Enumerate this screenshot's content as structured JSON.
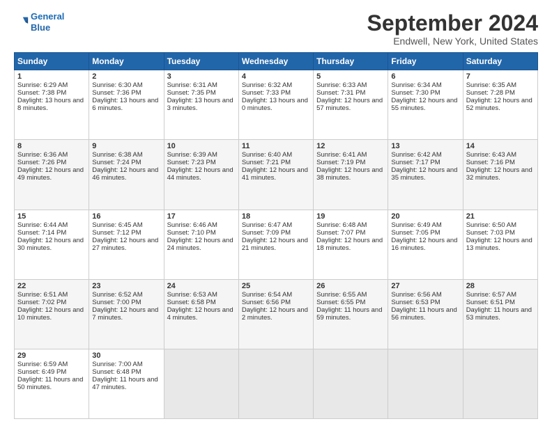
{
  "logo": {
    "line1": "General",
    "line2": "Blue"
  },
  "title": "September 2024",
  "location": "Endwell, New York, United States",
  "days_header": [
    "Sunday",
    "Monday",
    "Tuesday",
    "Wednesday",
    "Thursday",
    "Friday",
    "Saturday"
  ],
  "weeks": [
    [
      {
        "day": "1",
        "info": "Sunrise: 6:29 AM\nSunset: 7:38 PM\nDaylight: 13 hours and 8 minutes."
      },
      {
        "day": "2",
        "info": "Sunrise: 6:30 AM\nSunset: 7:36 PM\nDaylight: 13 hours and 6 minutes."
      },
      {
        "day": "3",
        "info": "Sunrise: 6:31 AM\nSunset: 7:35 PM\nDaylight: 13 hours and 3 minutes."
      },
      {
        "day": "4",
        "info": "Sunrise: 6:32 AM\nSunset: 7:33 PM\nDaylight: 13 hours and 0 minutes."
      },
      {
        "day": "5",
        "info": "Sunrise: 6:33 AM\nSunset: 7:31 PM\nDaylight: 12 hours and 57 minutes."
      },
      {
        "day": "6",
        "info": "Sunrise: 6:34 AM\nSunset: 7:30 PM\nDaylight: 12 hours and 55 minutes."
      },
      {
        "day": "7",
        "info": "Sunrise: 6:35 AM\nSunset: 7:28 PM\nDaylight: 12 hours and 52 minutes."
      }
    ],
    [
      {
        "day": "8",
        "info": "Sunrise: 6:36 AM\nSunset: 7:26 PM\nDaylight: 12 hours and 49 minutes."
      },
      {
        "day": "9",
        "info": "Sunrise: 6:38 AM\nSunset: 7:24 PM\nDaylight: 12 hours and 46 minutes."
      },
      {
        "day": "10",
        "info": "Sunrise: 6:39 AM\nSunset: 7:23 PM\nDaylight: 12 hours and 44 minutes."
      },
      {
        "day": "11",
        "info": "Sunrise: 6:40 AM\nSunset: 7:21 PM\nDaylight: 12 hours and 41 minutes."
      },
      {
        "day": "12",
        "info": "Sunrise: 6:41 AM\nSunset: 7:19 PM\nDaylight: 12 hours and 38 minutes."
      },
      {
        "day": "13",
        "info": "Sunrise: 6:42 AM\nSunset: 7:17 PM\nDaylight: 12 hours and 35 minutes."
      },
      {
        "day": "14",
        "info": "Sunrise: 6:43 AM\nSunset: 7:16 PM\nDaylight: 12 hours and 32 minutes."
      }
    ],
    [
      {
        "day": "15",
        "info": "Sunrise: 6:44 AM\nSunset: 7:14 PM\nDaylight: 12 hours and 30 minutes."
      },
      {
        "day": "16",
        "info": "Sunrise: 6:45 AM\nSunset: 7:12 PM\nDaylight: 12 hours and 27 minutes."
      },
      {
        "day": "17",
        "info": "Sunrise: 6:46 AM\nSunset: 7:10 PM\nDaylight: 12 hours and 24 minutes."
      },
      {
        "day": "18",
        "info": "Sunrise: 6:47 AM\nSunset: 7:09 PM\nDaylight: 12 hours and 21 minutes."
      },
      {
        "day": "19",
        "info": "Sunrise: 6:48 AM\nSunset: 7:07 PM\nDaylight: 12 hours and 18 minutes."
      },
      {
        "day": "20",
        "info": "Sunrise: 6:49 AM\nSunset: 7:05 PM\nDaylight: 12 hours and 16 minutes."
      },
      {
        "day": "21",
        "info": "Sunrise: 6:50 AM\nSunset: 7:03 PM\nDaylight: 12 hours and 13 minutes."
      }
    ],
    [
      {
        "day": "22",
        "info": "Sunrise: 6:51 AM\nSunset: 7:02 PM\nDaylight: 12 hours and 10 minutes."
      },
      {
        "day": "23",
        "info": "Sunrise: 6:52 AM\nSunset: 7:00 PM\nDaylight: 12 hours and 7 minutes."
      },
      {
        "day": "24",
        "info": "Sunrise: 6:53 AM\nSunset: 6:58 PM\nDaylight: 12 hours and 4 minutes."
      },
      {
        "day": "25",
        "info": "Sunrise: 6:54 AM\nSunset: 6:56 PM\nDaylight: 12 hours and 2 minutes."
      },
      {
        "day": "26",
        "info": "Sunrise: 6:55 AM\nSunset: 6:55 PM\nDaylight: 11 hours and 59 minutes."
      },
      {
        "day": "27",
        "info": "Sunrise: 6:56 AM\nSunset: 6:53 PM\nDaylight: 11 hours and 56 minutes."
      },
      {
        "day": "28",
        "info": "Sunrise: 6:57 AM\nSunset: 6:51 PM\nDaylight: 11 hours and 53 minutes."
      }
    ],
    [
      {
        "day": "29",
        "info": "Sunrise: 6:59 AM\nSunset: 6:49 PM\nDaylight: 11 hours and 50 minutes."
      },
      {
        "day": "30",
        "info": "Sunrise: 7:00 AM\nSunset: 6:48 PM\nDaylight: 11 hours and 47 minutes."
      },
      {
        "day": "",
        "info": ""
      },
      {
        "day": "",
        "info": ""
      },
      {
        "day": "",
        "info": ""
      },
      {
        "day": "",
        "info": ""
      },
      {
        "day": "",
        "info": ""
      }
    ]
  ]
}
